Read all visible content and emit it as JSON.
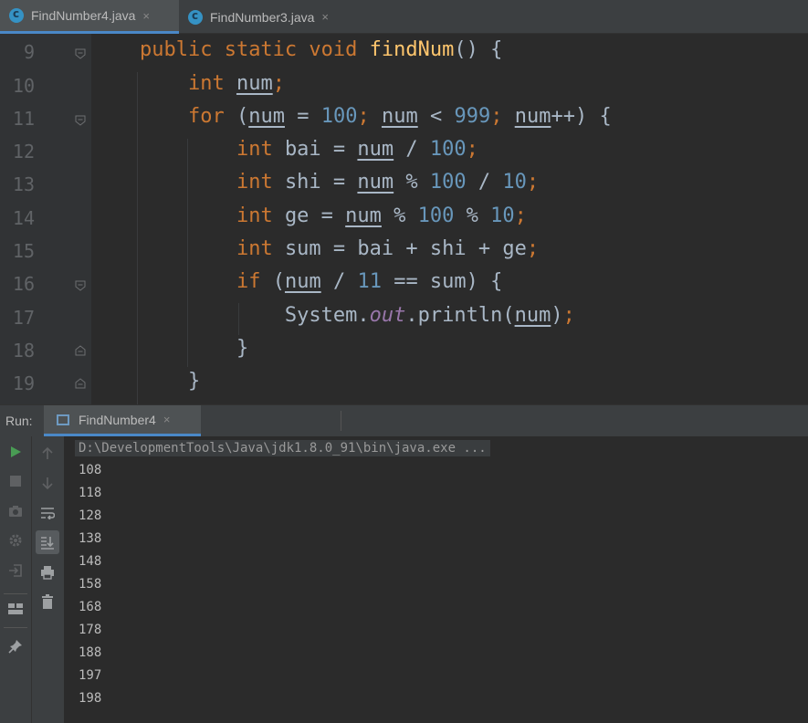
{
  "tabs": [
    {
      "label": "FindNumber4.java",
      "close": "×"
    },
    {
      "label": "FindNumber3.java",
      "close": "×"
    }
  ],
  "line_numbers": [
    "9",
    "10",
    "11",
    "12",
    "13",
    "14",
    "15",
    "16",
    "17",
    "18",
    "19"
  ],
  "code": {
    "l9": {
      "indent": "    ",
      "kw1": "public static void ",
      "fn": "findNum",
      "rest": "() {"
    },
    "l10": {
      "indent": "        ",
      "kw": "int ",
      "var": "num",
      "semi": ";"
    },
    "l11": {
      "indent": "        ",
      "kw": "for",
      "p1": " (",
      "v1": "num",
      "p2": " = ",
      "n1": "100",
      "p3": "; ",
      "v2": "num",
      "p4": " < ",
      "n2": "999",
      "p5": "; ",
      "v3": "num",
      "p6": "++) {"
    },
    "l12": {
      "indent": "            ",
      "kw": "int ",
      "p1": "bai = ",
      "v1": "num",
      "p2": " / ",
      "n1": "100",
      "semi": ";"
    },
    "l13": {
      "indent": "            ",
      "kw": "int ",
      "p1": "shi = ",
      "v1": "num",
      "p2": " % ",
      "n1": "100",
      "p3": " / ",
      "n2": "10",
      "semi": ";"
    },
    "l14": {
      "indent": "            ",
      "kw": "int ",
      "p1": "ge = ",
      "v1": "num",
      "p2": " % ",
      "n1": "100",
      "p3": " % ",
      "n2": "10",
      "semi": ";"
    },
    "l15": {
      "indent": "            ",
      "kw": "int ",
      "p1": "sum = bai + shi + ge",
      "semi": ";"
    },
    "l16": {
      "indent": "            ",
      "kw": "if",
      "p1": " (",
      "v1": "num",
      "p2": " / ",
      "n1": "11",
      "p3": " == sum) {"
    },
    "l17": {
      "indent": "                ",
      "p1": "System.",
      "st": "out",
      "p2": ".println(",
      "v1": "num",
      "p3": ")",
      "semi": ";"
    },
    "l18": {
      "indent": "            ",
      "p1": "}"
    },
    "l19": {
      "indent": "        ",
      "p1": "}"
    }
  },
  "run_panel": {
    "label": "Run:",
    "tab_label": "FindNumber4",
    "tab_close": "×",
    "command": "D:\\DevelopmentTools\\Java\\jdk1.8.0_91\\bin\\java.exe ...",
    "output": [
      "108",
      "118",
      "128",
      "138",
      "148",
      "158",
      "168",
      "178",
      "188",
      "197",
      "198"
    ]
  },
  "icons": {
    "rerun": "play-icon",
    "stop": "stop-icon",
    "dump": "camera-icon",
    "settings": "gear-icon",
    "exit": "exit-icon",
    "layout": "layout-icon",
    "pin": "pin-icon",
    "up": "arrow-up-icon",
    "down": "arrow-down-icon",
    "wrap": "soft-wrap-icon",
    "scroll": "scroll-to-end-icon",
    "print": "print-icon",
    "clear": "trash-icon"
  },
  "colors": {
    "keyword": "#cc7832",
    "number": "#6897bb",
    "method": "#ffc66d",
    "static_field": "#9876aa",
    "run_green": "#499c54"
  }
}
